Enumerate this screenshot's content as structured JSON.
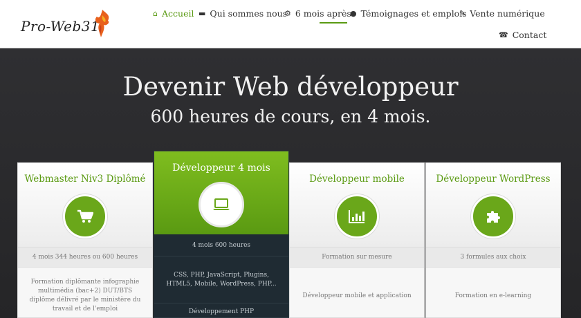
{
  "brand": {
    "name": "Pro-Web31",
    "accent": "#5a9a12"
  },
  "nav": [
    {
      "icon": "home-icon",
      "glyph": "⌂",
      "label": "Accueil",
      "active": true
    },
    {
      "icon": "briefcase-icon",
      "glyph": "▬",
      "label": "Qui sommes nous"
    },
    {
      "icon": "cogs-icon",
      "glyph": "⚙",
      "label": "6 mois après"
    },
    {
      "icon": "users-icon",
      "glyph": "●",
      "label": "Témoignages et emplois"
    },
    {
      "icon": "edit-icon",
      "glyph": "✎",
      "label": "Vente numérique"
    },
    {
      "icon": "phone-icon",
      "glyph": "☎",
      "label": "Contact"
    }
  ],
  "hero": {
    "title": "Devenir Web développeur",
    "subtitle": "600 heures de cours, en 4 mois."
  },
  "cards": [
    {
      "title": "Webmaster Niv3 Diplômé",
      "icon": "shopping-cart-icon",
      "info": "4 mois 344 heures ou 600 heures",
      "desc": "Formation diplômante infographie multimédia (bac+2) DUT/BTS diplôme délivré par le ministère du travail et de l'emploi"
    },
    {
      "title": "Développeur 4 mois",
      "icon": "laptop-icon",
      "info": "4 mois 600 heures",
      "desc": "CSS, PHP, JavaScript, Plugins, HTML5, Mobile, WordPress, PHP...",
      "extra": "Développement PHP"
    },
    {
      "title": "Développeur mobile",
      "icon": "bar-chart-icon",
      "info": "Formation sur mesure",
      "desc": "Développeur mobile et application"
    },
    {
      "title": "Développeur WordPress",
      "icon": "puzzle-piece-icon",
      "info": "3 formules aux choix",
      "desc": "Formation en e-learning"
    }
  ]
}
